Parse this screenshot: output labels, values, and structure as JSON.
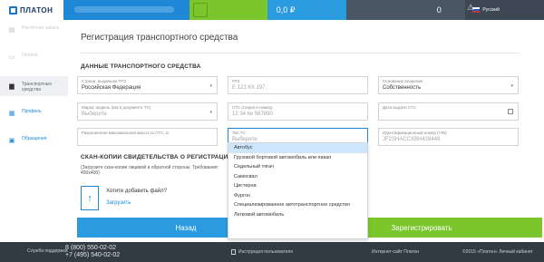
{
  "header": {
    "logo_text": "ПЛАТОН",
    "balance_main": "0,0 ₽",
    "balance_secondary": "0",
    "language": "Русский"
  },
  "sidebar": {
    "items": [
      {
        "label": "Расчётная запись"
      },
      {
        "label": "Оплата"
      },
      {
        "label": "Транспортные средства"
      },
      {
        "label": "Профиль"
      },
      {
        "label": "Обращения"
      }
    ]
  },
  "page": {
    "title": "Регистрация транспортного средства",
    "section_vehicle": "ДАННЫЕ ТРАНСПОРТНОГО СРЕДСТВА",
    "section_scans": "СКАН-КОПИИ СВИДЕТЕЛЬСТВА О РЕГИСТРАЦИИ",
    "scan_hint": "(Загрузите скан-копии лицевой и обратной стороны. Требования: 400х400)",
    "upload_question": "Хотите добавить файл?",
    "upload_link": "Загрузить"
  },
  "fields": {
    "country": {
      "label": "Страна, выдавшая ГРЗ",
      "value": "Российская Федерация"
    },
    "grz": {
      "label": "ГРЗ",
      "placeholder": "Е 123 КХ 197"
    },
    "ownership": {
      "label": "Основание владения",
      "value": "Собственность"
    },
    "brand": {
      "label": "Марка, модель (как в документе ТС)",
      "placeholder": "Выберите"
    },
    "sts": {
      "label": "СТС (Серия и номер)",
      "placeholder": "12 34 № 567890"
    },
    "sts_date": {
      "label": "Дата выдачи СТС",
      "placeholder": ""
    },
    "max_mass": {
      "label": "Разрешенная максимальная масса по СТС, кг",
      "placeholder": ""
    },
    "vehicle_type": {
      "label": "Тип ТС",
      "placeholder": "Выберите"
    },
    "vin": {
      "label": "Идентификационный номер (VIN)",
      "placeholder": "JF2SHACCXBH428449"
    }
  },
  "vehicle_type_options": [
    "Автобус",
    "Грузовой бортовой автомобиль или пикап",
    "Седельный тягач",
    "Самосвал",
    "Цистерна",
    "Фургон",
    "Специализированное автотранспортное средство",
    "Легковой автомобиль"
  ],
  "buttons": {
    "back": "Назад",
    "register": "Зарегистрировать"
  },
  "footer": {
    "support": "Служба поддержки",
    "phone1": "8 (800) 550-02-02",
    "phone2": "+7 (495) 540-02-02",
    "manual": "Инструкция пользователя",
    "site": "Интернет-сайт Платон",
    "copyright": "©2015 «Платон» Личный кабинет"
  },
  "colors": {
    "accent_blue": "#2b9be0",
    "accent_green": "#7bc62d",
    "footer_dark": "#323a43"
  }
}
